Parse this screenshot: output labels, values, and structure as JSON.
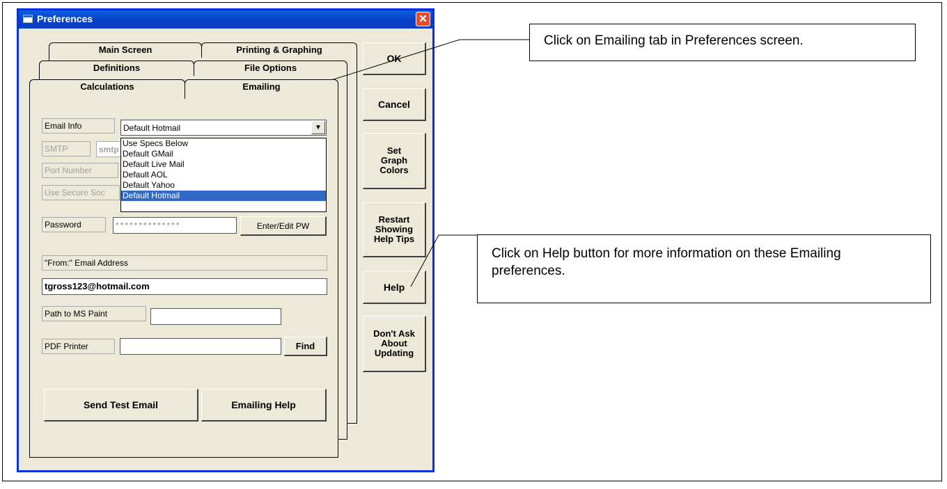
{
  "window": {
    "title": "Preferences",
    "close": "✕"
  },
  "tabs": {
    "main_screen": "Main Screen",
    "printing": "Printing & Graphing",
    "definitions": "Definitions",
    "file_options": "File Options",
    "calculations": "Calculations",
    "emailing": "Emailing"
  },
  "email": {
    "info_label": "Email Info",
    "info_value": "Default Hotmail",
    "smtp_label": "SMTP",
    "smtp_value": "smtp",
    "port_label": "Port Number",
    "secure_label": "Use Secure Soc",
    "password_label": "Password",
    "password_value": "**************",
    "enter_pw": "Enter/Edit PW",
    "from_label": "\"From:\" Email Address",
    "from_value": "tgross123@hotmail.com",
    "paint_label": "Path to MS Paint",
    "paint_value": "",
    "pdf_label": "PDF Printer",
    "pdf_value": "",
    "find": "Find",
    "send_test": "Send Test Email",
    "emailing_help": "Emailing Help"
  },
  "dropdown": {
    "options": [
      "Use Specs Below",
      "Default GMail",
      "Default Live Mail",
      "Default AOL",
      "Default Yahoo",
      "Default Hotmail"
    ],
    "selected": "Default Hotmail"
  },
  "side_buttons": {
    "ok": "OK",
    "cancel": "Cancel",
    "graph_colors": [
      "Set",
      "Graph",
      "Colors"
    ],
    "help_tips": [
      "Restart",
      "Showing",
      "Help Tips"
    ],
    "help": "Help",
    "dont_ask": [
      "Don't Ask",
      "About",
      "Updating"
    ]
  },
  "callouts": {
    "emailing_tab": "Click on Emailing tab in Preferences screen.",
    "help_button": "Click on Help button for more information on these Emailing preferences."
  },
  "colors": {
    "title_bar": "#0842c8",
    "selection": "#316ac5",
    "dialog_bg": "#ece9d8"
  }
}
